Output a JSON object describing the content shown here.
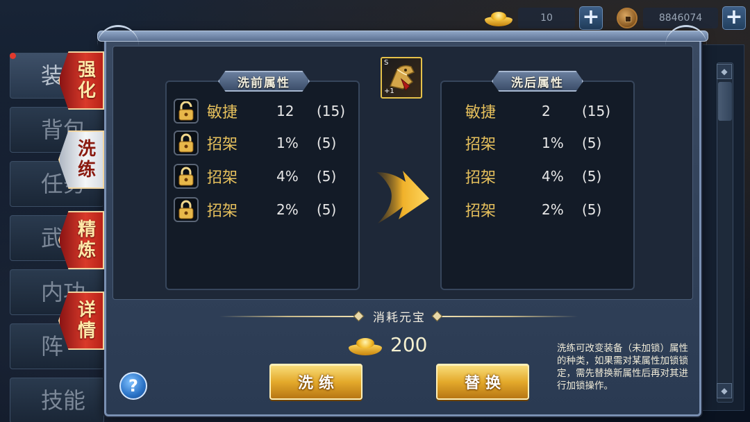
{
  "currency": {
    "ingot_count": "10",
    "coin_count": "8846074"
  },
  "left_tabs": [
    "装",
    "背包",
    "任务",
    "武",
    "内功",
    "阵",
    "技能"
  ],
  "side_ribbons": [
    {
      "label": "强化",
      "active": false
    },
    {
      "label": "洗练",
      "active": true
    },
    {
      "label": "精炼",
      "active": false
    },
    {
      "label": "详情",
      "active": false
    }
  ],
  "item": {
    "grade": "S",
    "level": "+1"
  },
  "before": {
    "title": "洗前属性",
    "rows": [
      {
        "name": "敏捷",
        "value": "12",
        "max": "(15)",
        "locked": false
      },
      {
        "name": "招架",
        "value": "1%",
        "max": "(5)",
        "locked": true
      },
      {
        "name": "招架",
        "value": "4%",
        "max": "(5)",
        "locked": true
      },
      {
        "name": "招架",
        "value": "2%",
        "max": "(5)",
        "locked": true
      }
    ]
  },
  "after": {
    "title": "洗后属性",
    "rows": [
      {
        "name": "敏捷",
        "value": "2",
        "max": "(15)"
      },
      {
        "name": "招架",
        "value": "1%",
        "max": "(5)"
      },
      {
        "name": "招架",
        "value": "4%",
        "max": "(5)"
      },
      {
        "name": "招架",
        "value": "2%",
        "max": "(5)"
      }
    ]
  },
  "cost": {
    "label": "消耗元宝",
    "amount": "200"
  },
  "buttons": {
    "wash": "洗练",
    "replace": "替换",
    "help": "?"
  },
  "hint": "洗练可改变装备（未加锁）属性的种类，如果需对某属性加锁锁定，需先替换新属性后再对其进行加锁操作。",
  "colors": {
    "accent_gold": "#e6c05c",
    "ribbon_red": "#d93a2a",
    "button_gold": "#e4aa2c"
  }
}
